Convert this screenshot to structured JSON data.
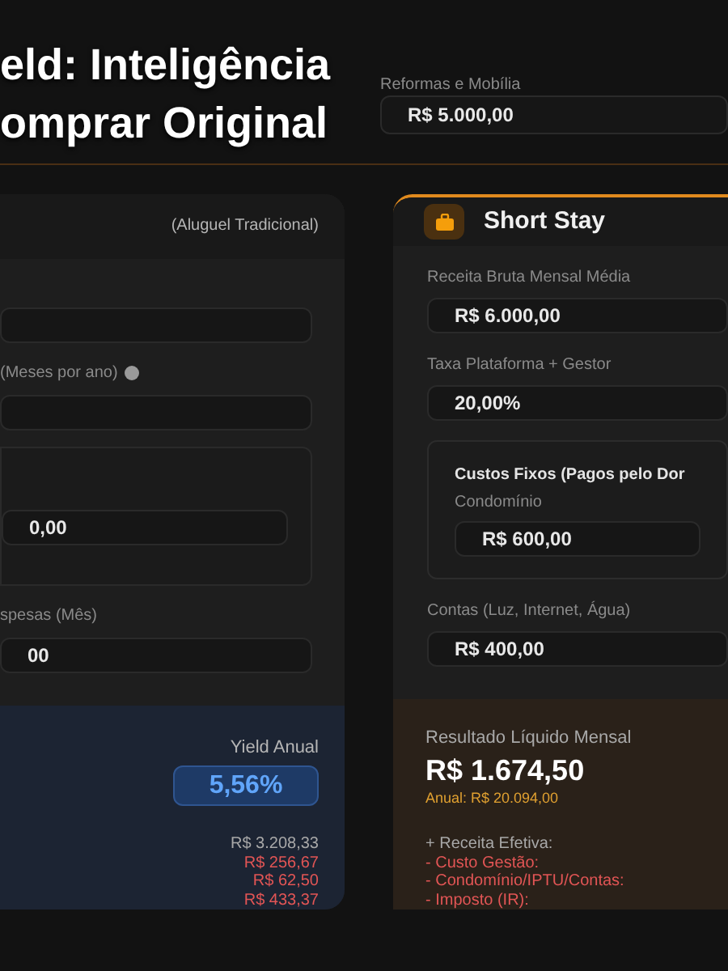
{
  "caption": {
    "lines": [
      "eld: Inteligência",
      "omprar Original"
    ]
  },
  "top_fields": [
    {
      "label": "Reformas e Mobília",
      "value": "R$ 5.000,00"
    }
  ],
  "traditional": {
    "subtitle": "(Aluguel Tradicional)",
    "fields": [
      {
        "kind": "field"
      },
      {
        "kind": "field",
        "label": "(Meses por ano)",
        "info": true
      },
      {
        "kind": "group",
        "value": "0,00"
      },
      {
        "kind": "field",
        "label": "spesas (Mês)",
        "value": "00"
      }
    ],
    "result": {
      "yield_label": "Yield Anual",
      "yield_value": "5,56%",
      "lines": [
        {
          "text": "R$ 3.208,33",
          "negative": false
        },
        {
          "text": "R$ 256,67",
          "negative": true
        },
        {
          "text": "R$ 62,50",
          "negative": true
        },
        {
          "text": "R$ 433,37",
          "negative": true
        }
      ]
    }
  },
  "short_stay": {
    "title": "Short Stay",
    "fields": [
      {
        "kind": "field",
        "label": "Receita Bruta Mensal Média",
        "value": "R$ 6.000,00"
      },
      {
        "kind": "field",
        "label": "Taxa Plataforma + Gestor",
        "value": "20,00%"
      },
      {
        "kind": "group",
        "title": "Custos Fixos (Pagos pelo Dor",
        "label": "Condomínio",
        "value": "R$ 600,00"
      },
      {
        "kind": "field",
        "label": "Contas (Luz, Internet, Água)",
        "value": "R$ 400,00"
      }
    ],
    "result": {
      "label": "Resultado Líquido Mensal",
      "value": "R$ 1.674,50",
      "annual": "Anual: R$ 20.094,00",
      "lines": [
        {
          "text": "+ Receita Efetiva:",
          "negative": false
        },
        {
          "text": "- Custo Gestão:",
          "negative": true
        },
        {
          "text": "- Condomínio/IPTU/Contas:",
          "negative": true
        },
        {
          "text": "- Imposto (IR):",
          "negative": true
        }
      ]
    }
  }
}
